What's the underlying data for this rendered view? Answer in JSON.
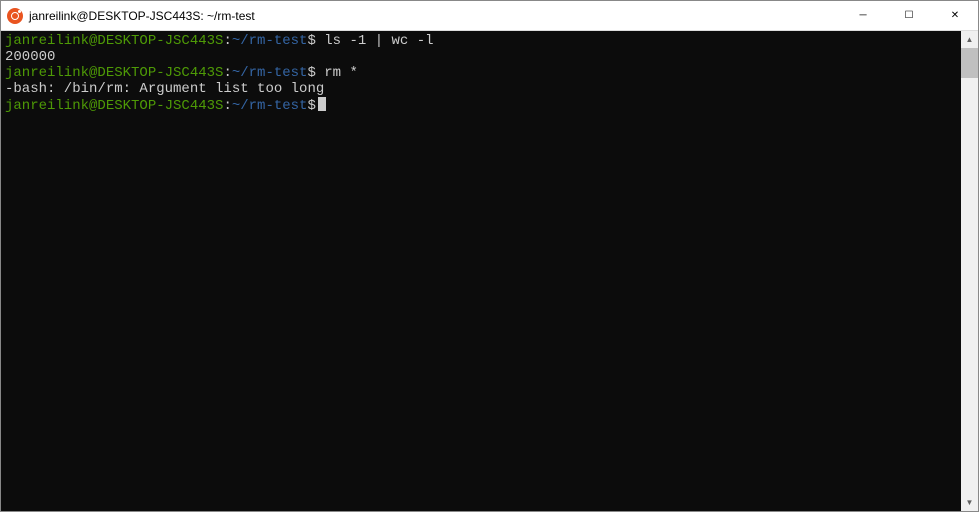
{
  "window": {
    "title": "janreilink@DESKTOP-JSC443S: ~/rm-test"
  },
  "controls": {
    "minimize": "─",
    "maximize": "☐",
    "close": "✕"
  },
  "terminal": {
    "prompt_user_host": "janreilink@DESKTOP-JSC443S",
    "prompt_colon": ":",
    "prompt_path": "~/rm-test",
    "prompt_symbol": "$",
    "lines": {
      "cmd1": "ls -1 | wc -l",
      "out1": "200000",
      "cmd2": "rm *",
      "out2": "-bash: /bin/rm: Argument list too long"
    }
  },
  "scrollbar": {
    "up": "▲",
    "down": "▼"
  }
}
